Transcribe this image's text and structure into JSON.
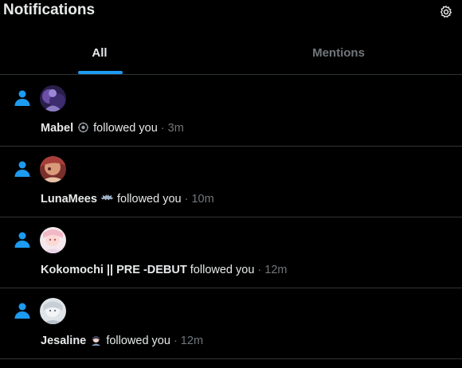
{
  "header": {
    "title": "Notifications",
    "settings_icon": "gear-icon"
  },
  "tabs": [
    {
      "label": "All",
      "active": true
    },
    {
      "label": "Mentions",
      "active": false
    }
  ],
  "colors": {
    "accent": "#1d9bf0",
    "background": "#000000",
    "text": "#e7e9ea",
    "muted": "#71767b",
    "divider": "#2f3336"
  },
  "notifications": [
    {
      "username": "Mabel",
      "action": "followed you",
      "time": "· 3m",
      "icon": "person-icon"
    },
    {
      "username": "LunaMees",
      "action": "followed you",
      "time": "· 10m",
      "icon": "person-icon"
    },
    {
      "username": "Kokomochi || PRE -DEBUT",
      "action": "followed you",
      "time": "· 12m",
      "icon": "person-icon"
    },
    {
      "username": "Jesaline",
      "action": "followed you",
      "time": "· 12m",
      "icon": "person-icon"
    }
  ]
}
